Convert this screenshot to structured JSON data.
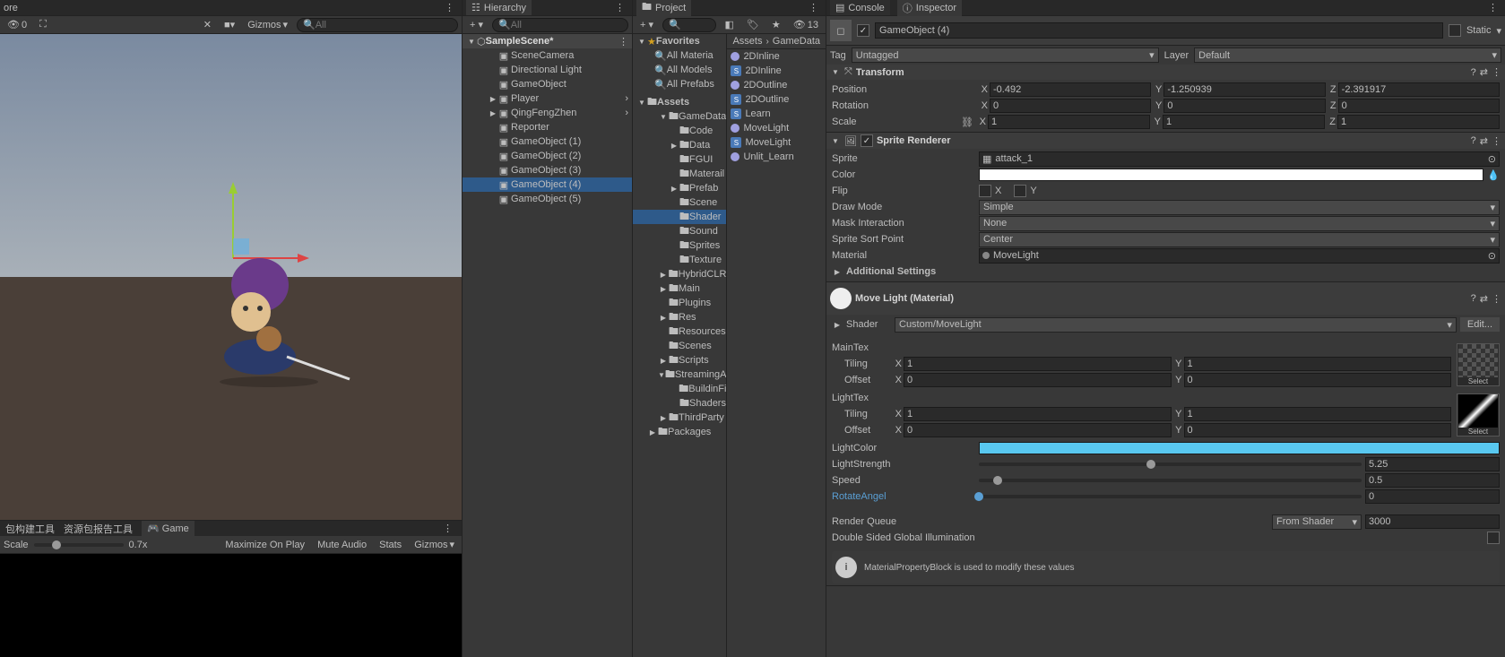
{
  "scene": {
    "toolbar": {
      "gizmos": "Gizmos",
      "search_placeholder": "All",
      "count0": "0",
      "count13": "13"
    },
    "bottom_tabs": [
      "包构建工具",
      "资源包报告工具",
      "Game"
    ],
    "scale_label": "Scale",
    "scale_value": "0.7x",
    "maximize": "Maximize On Play",
    "mute": "Mute Audio",
    "stats": "Stats",
    "gizmos2": "Gizmos"
  },
  "hierarchy": {
    "title": "Hierarchy",
    "search_placeholder": "All",
    "scene_name": "SampleScene*",
    "items": [
      {
        "label": "SceneCamera",
        "depth": 1
      },
      {
        "label": "Directional Light",
        "depth": 1
      },
      {
        "label": "GameObject",
        "depth": 1
      },
      {
        "label": "Player",
        "depth": 1,
        "blue": true,
        "arrow": "▶"
      },
      {
        "label": "QingFengZhen",
        "depth": 1,
        "blue": true,
        "arrow": "▶"
      },
      {
        "label": "Reporter",
        "depth": 1
      },
      {
        "label": "GameObject (1)",
        "depth": 1,
        "dim": true
      },
      {
        "label": "GameObject (2)",
        "depth": 1,
        "dim": true
      },
      {
        "label": "GameObject (3)",
        "depth": 1,
        "dim": true
      },
      {
        "label": "GameObject (4)",
        "depth": 1,
        "sel": true
      },
      {
        "label": "GameObject (5)",
        "depth": 1,
        "dim": true
      }
    ]
  },
  "project": {
    "title": "Project",
    "breadcrumb": [
      "Assets",
      "GameData"
    ],
    "count13": "13",
    "favorites_label": "Favorites",
    "favorites": [
      "All Materia",
      "All Models",
      "All Prefabs"
    ],
    "assets_label": "Assets",
    "folders": [
      {
        "label": "GameData",
        "depth": 1,
        "open": true
      },
      {
        "label": "Code",
        "depth": 2
      },
      {
        "label": "Data",
        "depth": 2,
        "arrow": "▶"
      },
      {
        "label": "FGUI",
        "depth": 2
      },
      {
        "label": "Materail",
        "depth": 2
      },
      {
        "label": "Prefab",
        "depth": 2,
        "arrow": "▶"
      },
      {
        "label": "Scene",
        "depth": 2
      },
      {
        "label": "Shader",
        "depth": 2,
        "sel": true
      },
      {
        "label": "Sound",
        "depth": 2
      },
      {
        "label": "Sprites",
        "depth": 2
      },
      {
        "label": "Texture",
        "depth": 2
      },
      {
        "label": "HybridCLR",
        "depth": 1,
        "arrow": "▶"
      },
      {
        "label": "Main",
        "depth": 1,
        "arrow": "▶"
      },
      {
        "label": "Plugins",
        "depth": 1
      },
      {
        "label": "Res",
        "depth": 1,
        "arrow": "▶"
      },
      {
        "label": "Resources",
        "depth": 1
      },
      {
        "label": "Scenes",
        "depth": 1
      },
      {
        "label": "Scripts",
        "depth": 1,
        "arrow": "▶"
      },
      {
        "label": "StreamingA",
        "depth": 1,
        "arrow": "▼"
      },
      {
        "label": "BuildinFi",
        "depth": 2
      },
      {
        "label": "Shaders",
        "depth": 2
      },
      {
        "label": "ThirdParty",
        "depth": 1,
        "arrow": "▶"
      },
      {
        "label": "Packages",
        "depth": 0,
        "arrow": "▶"
      }
    ],
    "right_items": [
      {
        "label": "2DInline",
        "type": "mat"
      },
      {
        "label": "2DInline",
        "type": "shader"
      },
      {
        "label": "2DOutline",
        "type": "mat"
      },
      {
        "label": "2DOutline",
        "type": "shader"
      },
      {
        "label": "Learn",
        "type": "shader"
      },
      {
        "label": "MoveLight",
        "type": "mat"
      },
      {
        "label": "MoveLight",
        "type": "shader"
      },
      {
        "label": "Unlit_Learn",
        "type": "mat"
      }
    ]
  },
  "inspector": {
    "console_tab": "Console",
    "inspector_tab": "Inspector",
    "name": "GameObject (4)",
    "static": "Static",
    "tag_label": "Tag",
    "tag": "Untagged",
    "layer_label": "Layer",
    "layer": "Default",
    "transform": {
      "title": "Transform",
      "position": "Position",
      "rotation": "Rotation",
      "scale": "Scale",
      "pos": {
        "x": "-0.492",
        "y": "-1.250939",
        "z": "-2.391917"
      },
      "rot": {
        "x": "0",
        "y": "0",
        "z": "0"
      },
      "scl": {
        "x": "1",
        "y": "1",
        "z": "1"
      }
    },
    "sprite": {
      "title": "Sprite Renderer",
      "sprite_label": "Sprite",
      "sprite_val": "attack_1",
      "color_label": "Color",
      "color_val": "#ffffff",
      "flip_label": "Flip",
      "flip_x": "X",
      "flip_y": "Y",
      "draw_label": "Draw Mode",
      "draw_val": "Simple",
      "mask_label": "Mask Interaction",
      "mask_val": "None",
      "sort_label": "Sprite Sort Point",
      "sort_val": "Center",
      "mat_label": "Material",
      "mat_val": "MoveLight",
      "additional": "Additional Settings"
    },
    "material": {
      "title": "Move Light (Material)",
      "shader_label": "Shader",
      "shader_val": "Custom/MoveLight",
      "edit": "Edit...",
      "maintex": "MainTex",
      "tiling": "Tiling",
      "offset": "Offset",
      "mt_tile": {
        "x": "1",
        "y": "1"
      },
      "mt_off": {
        "x": "0",
        "y": "0"
      },
      "lighttex": "LightTex",
      "lt_tile": {
        "x": "1",
        "y": "1"
      },
      "lt_off": {
        "x": "0",
        "y": "0"
      },
      "lightcolor": "LightColor",
      "lightcolor_val": "#59c8f0",
      "lightstrength": "LightStrength",
      "lightstrength_val": "5.25",
      "speed": "Speed",
      "speed_val": "0.5",
      "rotate": "RotateAngel",
      "rotate_val": "0",
      "render_queue": "Render Queue",
      "rq_mode": "From Shader",
      "rq_val": "3000",
      "double_sided": "Double Sided Global Illumination",
      "select": "Select",
      "warning": "MaterialPropertyBlock is used to modify these values"
    }
  }
}
